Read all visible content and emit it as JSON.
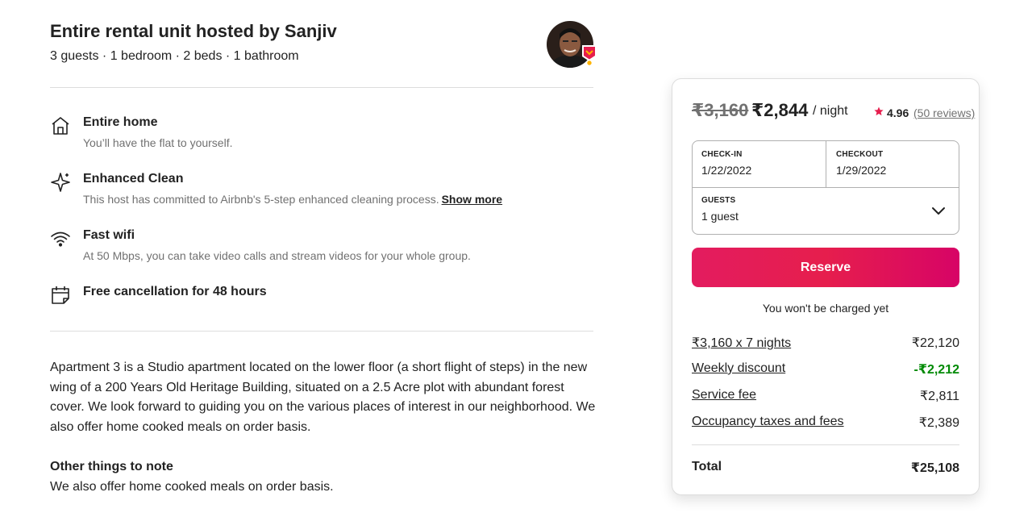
{
  "host": {
    "title": "Entire rental unit hosted by Sanjiv",
    "subtitle": "3 guests · 1 bedroom · 2 beds · 1 bathroom",
    "avatar_icon": "host-avatar",
    "superhost_badge_icon": "superhost-badge-icon"
  },
  "features": [
    {
      "icon": "home-icon",
      "title": "Entire home",
      "description": "You’ll have the flat to yourself."
    },
    {
      "icon": "sparkle-icon",
      "title": "Enhanced Clean",
      "description": "This host has committed to Airbnb's 5-step enhanced cleaning process.",
      "link": "Show more"
    },
    {
      "icon": "wifi-icon",
      "title": "Fast wifi",
      "description": "At 50 Mbps, you can take video calls and stream videos for your whole group."
    },
    {
      "icon": "calendar-icon",
      "title": "Free cancellation for 48 hours"
    }
  ],
  "description": "Apartment 3 is a Studio apartment located on the lower floor (a short flight of steps) in the new wing of a 200 Years Old Heritage Building, situated on a 2.5 Acre plot with abundant forest cover. We look forward to guiding you on the various places of interest in our neighborhood. We also offer home cooked meals on order basis.",
  "other": {
    "title": "Other things to note",
    "text": "We also offer home cooked meals on order basis."
  },
  "booking": {
    "old_price": "₹3,160",
    "new_price": "₹2,844",
    "per_night": "/ night",
    "rating": "4.96",
    "reviews": "(50 reviews)",
    "checkin_label": "CHECK-IN",
    "checkin_value": "1/22/2022",
    "checkout_label": "CHECKOUT",
    "checkout_value": "1/29/2022",
    "guests_label": "GUESTS",
    "guests_value": "1 guest",
    "reserve_label": "Reserve",
    "no_charge": "You won't be charged yet",
    "line_items": [
      {
        "label": "₹3,160 x 7 nights",
        "amount": "₹22,120"
      },
      {
        "label": "Weekly discount",
        "amount": "-₹2,212"
      },
      {
        "label": "Service fee",
        "amount": "₹2,811"
      },
      {
        "label": "Occupancy taxes and fees",
        "amount": "₹2,389"
      }
    ],
    "total_label": "Total",
    "total_amount": "₹25,108"
  },
  "colors": {
    "brand": "#e61e4d",
    "discount_green": "#008a05",
    "star": "#e61e4d"
  }
}
